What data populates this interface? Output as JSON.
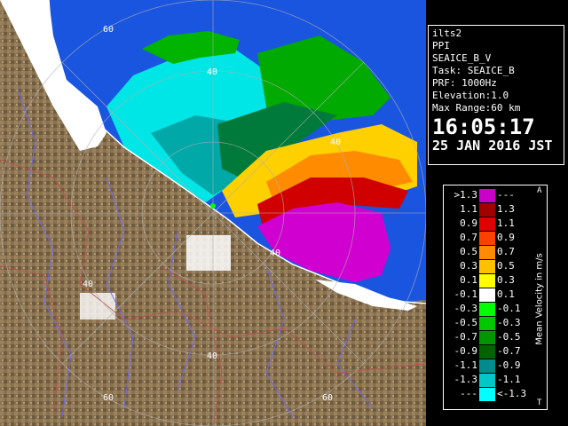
{
  "header": {
    "site": "ilts2",
    "product": "PPI",
    "parameter": "SEAICE_B_V",
    "task": "Task: SEAICE_B",
    "prf": "PRF: 1000Hz",
    "elevation": "Elevation:1.0",
    "max_range": "Max Range:60 km",
    "time": "16:05:17",
    "date": "25 JAN 2016 JST"
  },
  "range_rings": {
    "labels": [
      "40",
      "60",
      "40",
      "40",
      "40",
      "60",
      "40",
      "60"
    ]
  },
  "legend": {
    "title": "Mean Velocity in m/s",
    "corner_top": "A",
    "corner_bottom": "T",
    "rows": [
      {
        "left": ">1.3",
        "right": "---",
        "color": "#c800c8"
      },
      {
        "left": "1.1",
        "right": "1.3",
        "color": "#a00000"
      },
      {
        "left": "0.9",
        "right": "1.1",
        "color": "#e00000"
      },
      {
        "left": "0.7",
        "right": "0.9",
        "color": "#ff4000"
      },
      {
        "left": "0.5",
        "right": "0.7",
        "color": "#ff8c00"
      },
      {
        "left": "0.3",
        "right": "0.5",
        "color": "#ffc000"
      },
      {
        "left": "0.1",
        "right": "0.3",
        "color": "#ffff00"
      },
      {
        "left": "-0.1",
        "right": "0.1",
        "color": "#ffffff"
      },
      {
        "left": "-0.3",
        "right": "-0.1",
        "color": "#00ff00"
      },
      {
        "left": "-0.5",
        "right": "-0.3",
        "color": "#00c800"
      },
      {
        "left": "-0.7",
        "right": "-0.5",
        "color": "#009600"
      },
      {
        "left": "-0.9",
        "right": "-0.7",
        "color": "#006400"
      },
      {
        "left": "-1.1",
        "right": "-0.9",
        "color": "#008c8c"
      },
      {
        "left": "-1.3",
        "right": "-1.1",
        "color": "#00c8c8"
      },
      {
        "left": "---",
        "right": "<-1.3",
        "color": "#00ffff"
      }
    ]
  },
  "colors": {
    "land": "#8b7355",
    "sea": "#1a4fd6",
    "snow": "#ffffff",
    "rivers": "#6a6aff",
    "borders": "#c0504d"
  }
}
